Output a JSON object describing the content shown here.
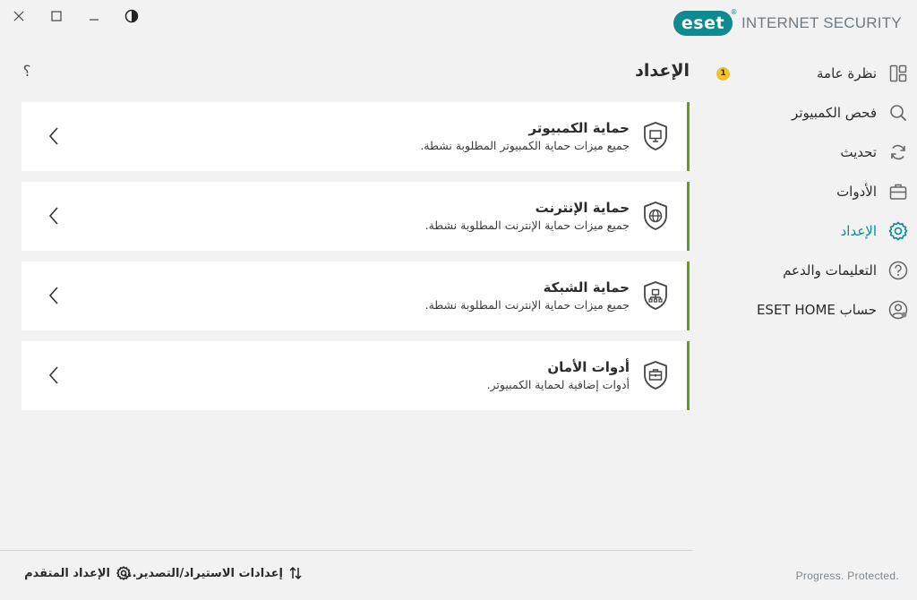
{
  "window": {
    "close_label": "×",
    "icons": [
      "close-icon",
      "maximize-icon",
      "minimize-icon",
      "theme-contrast-icon"
    ]
  },
  "brand": {
    "logo_text": "eset",
    "product_name": "INTERNET SECURITY",
    "accent_color": "#0f8a8f",
    "tagline": "Progress. Protected."
  },
  "sidebar": {
    "items": [
      {
        "label": "نظرة عامة",
        "icon": "overview-grid-icon",
        "badge": "1"
      },
      {
        "label": "فحص الكمبيوتر",
        "icon": "search-icon"
      },
      {
        "label": "تحديث",
        "icon": "refresh-icon"
      },
      {
        "label": "الأدوات",
        "icon": "toolbox-icon"
      },
      {
        "label": "الإعداد",
        "icon": "gear-icon",
        "active": true
      },
      {
        "label": "التعليمات والدعم",
        "icon": "help-circle-icon"
      },
      {
        "label": "حساب ESET HOME",
        "icon": "account-icon"
      }
    ]
  },
  "main": {
    "title": "الإعداد",
    "help_label": "؟",
    "status_color": "#6a9a1f",
    "cards": [
      {
        "title": "حماية الكمبيوتر",
        "description": "جميع ميزات حماية الكمبيوتر المطلوبة نشطة.",
        "icon": "shield-monitor-icon"
      },
      {
        "title": "حماية الإنترنت",
        "description": "جميع ميزات حماية الإنترنت المطلوبة نشطة.",
        "icon": "shield-globe-icon"
      },
      {
        "title": "حماية الشبكة",
        "description": "جميع ميزات حماية الإنترنت المطلوبة نشطة.",
        "icon": "shield-network-icon"
      },
      {
        "title": "أدوات الأمان",
        "description": "أدوات إضافية لحماية الكمبيوتر.",
        "icon": "shield-toolbox-icon"
      }
    ]
  },
  "footer": {
    "import_export_label": "إعدادات الاستيراد/التصدير...",
    "advanced_setup_label": "الإعداد المتقدم"
  }
}
